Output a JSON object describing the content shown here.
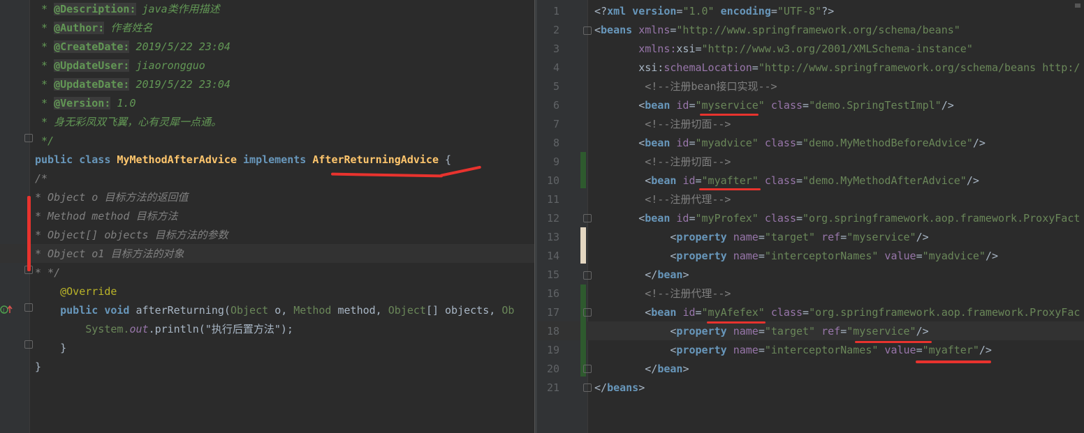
{
  "left_editor": {
    "lines": [
      {
        "parts": [
          [
            "jdoc",
            " * "
          ],
          [
            "jdtag",
            "@Description:"
          ],
          [
            "jdoc",
            " java类作用描述"
          ]
        ]
      },
      {
        "parts": [
          [
            "jdoc",
            " * "
          ],
          [
            "jdtag",
            "@Author:"
          ],
          [
            "jdoc",
            " 作者姓名"
          ]
        ]
      },
      {
        "parts": [
          [
            "jdoc",
            " * "
          ],
          [
            "jdtag",
            "@CreateDate:"
          ],
          [
            "jdoc",
            " 2019/5/22 23:04"
          ]
        ]
      },
      {
        "parts": [
          [
            "jdoc",
            " * "
          ],
          [
            "jdtag",
            "@UpdateUser:"
          ],
          [
            "jdoc",
            " jiaorongguo"
          ]
        ]
      },
      {
        "parts": [
          [
            "jdoc",
            " * "
          ],
          [
            "jdtag",
            "@UpdateDate:"
          ],
          [
            "jdoc",
            " 2019/5/22 23:04"
          ]
        ]
      },
      {
        "parts": [
          [
            "jdoc",
            " * "
          ],
          [
            "jdtag",
            "@Version:"
          ],
          [
            "jdoc",
            " 1.0"
          ]
        ]
      },
      {
        "parts": [
          [
            "jdoc",
            " * 身无彩凤双飞翼，心有灵犀一点通。"
          ]
        ]
      },
      {
        "parts": [
          [
            "jdoc",
            " */"
          ]
        ]
      },
      {
        "parts": [
          [
            "kwb",
            "public class "
          ],
          [
            "iface",
            "MyMethodAfterAdvice"
          ],
          [
            "kwb",
            " implements "
          ],
          [
            "iface",
            "AfterReturningAdvice"
          ],
          [
            "plain",
            " {"
          ]
        ]
      },
      {
        "parts": [
          [
            "comment-grey",
            "/*"
          ]
        ]
      },
      {
        "parts": [
          [
            "comment-grey",
            "* Object o 目标方法的返回值"
          ]
        ]
      },
      {
        "parts": [
          [
            "comment-grey",
            "* Method method 目标方法"
          ]
        ]
      },
      {
        "parts": [
          [
            "comment-grey",
            "* Object[] objects 目标方法的参数"
          ]
        ]
      },
      {
        "parts": [
          [
            "comment-grey",
            "* Object o1 目标方法的对象"
          ]
        ]
      },
      {
        "parts": [
          [
            "comment-grey",
            "* */"
          ]
        ]
      },
      {
        "parts": [
          [
            "ann",
            "    @Override"
          ]
        ]
      },
      {
        "parts": [
          [
            "kwb",
            "    public void "
          ],
          [
            "plain",
            "afterReturning("
          ],
          [
            "xmlval",
            "Object "
          ],
          [
            "plain",
            "o, "
          ],
          [
            "xmlval",
            "Method "
          ],
          [
            "plain",
            "method, "
          ],
          [
            "xmlval",
            "Object"
          ],
          [
            "plain",
            "[] objects, "
          ],
          [
            "xmlval",
            "Ob"
          ]
        ]
      },
      {
        "parts": [
          [
            "plain",
            "        "
          ],
          [
            "xmlval",
            "System."
          ],
          [
            "field",
            "out"
          ],
          [
            "plain",
            ".println("
          ],
          [
            "plain",
            "\"执行后置方法\""
          ],
          [
            "plain",
            ");"
          ]
        ]
      },
      {
        "parts": [
          [
            "plain",
            "    }"
          ]
        ]
      },
      {
        "parts": [
          [
            "plain",
            "}"
          ]
        ]
      }
    ]
  },
  "right_editor": {
    "lines": [
      {
        "n": "1",
        "parts": [
          [
            "plain",
            "<?"
          ],
          [
            "kwb",
            "xml version"
          ],
          [
            "plain",
            "="
          ],
          [
            "xmlval",
            "\"1.0\""
          ],
          [
            "kwb",
            " encoding"
          ],
          [
            "plain",
            "="
          ],
          [
            "xmlval",
            "\"UTF-8\""
          ],
          [
            "plain",
            "?>"
          ]
        ]
      },
      {
        "n": "2",
        "parts": [
          [
            "plain",
            "<"
          ],
          [
            "kwb",
            "beans "
          ],
          [
            "attr",
            "xmlns"
          ],
          [
            "plain",
            "="
          ],
          [
            "xmlval",
            "\"http://www.springframework.org/schema/beans\""
          ]
        ]
      },
      {
        "n": "3",
        "parts": [
          [
            "plain",
            "       "
          ],
          [
            "attr",
            "xmlns:"
          ],
          [
            "plain",
            "xsi="
          ],
          [
            "xmlval",
            "\"http://www.w3.org/2001/XMLSchema-instance\""
          ]
        ]
      },
      {
        "n": "4",
        "parts": [
          [
            "plain",
            "       xsi:"
          ],
          [
            "attr",
            "schemaLocation"
          ],
          [
            "plain",
            "="
          ],
          [
            "xmlval",
            "\"http://www.springframework.org/schema/beans http:/"
          ]
        ]
      },
      {
        "n": "5",
        "parts": [
          [
            "xmlcm",
            "        <!--注册bean接口实现-->"
          ]
        ]
      },
      {
        "n": "6",
        "parts": [
          [
            "plain",
            "       <"
          ],
          [
            "kwb",
            "bean "
          ],
          [
            "attr",
            "id"
          ],
          [
            "plain",
            "="
          ],
          [
            "xmlval",
            "\"myservice\""
          ],
          [
            "attr",
            " class"
          ],
          [
            "plain",
            "="
          ],
          [
            "xmlval",
            "\"demo.SpringTestImpl\""
          ],
          [
            "plain",
            "/>"
          ]
        ]
      },
      {
        "n": "7",
        "parts": [
          [
            "xmlcm",
            "        <!--注册切面-->"
          ]
        ]
      },
      {
        "n": "8",
        "parts": [
          [
            "plain",
            "       <"
          ],
          [
            "kwb",
            "bean "
          ],
          [
            "attr",
            "id"
          ],
          [
            "plain",
            "="
          ],
          [
            "xmlval",
            "\"myadvice\""
          ],
          [
            "attr",
            " class"
          ],
          [
            "plain",
            "="
          ],
          [
            "xmlval",
            "\"demo.MyMethodBeforeAdvice\""
          ],
          [
            "plain",
            "/>"
          ]
        ]
      },
      {
        "n": "9",
        "parts": [
          [
            "xmlcm",
            "        <!--注册切面-->"
          ]
        ]
      },
      {
        "n": "10",
        "parts": [
          [
            "plain",
            "        <"
          ],
          [
            "kwb",
            "bean "
          ],
          [
            "attr",
            "id"
          ],
          [
            "plain",
            "="
          ],
          [
            "xmlval",
            "\"myafter\""
          ],
          [
            "attr",
            " class"
          ],
          [
            "plain",
            "="
          ],
          [
            "xmlval",
            "\"demo.MyMethodAfterAdvice\""
          ],
          [
            "plain",
            "/>"
          ]
        ]
      },
      {
        "n": "11",
        "parts": [
          [
            "xmlcm",
            "        <!--注册代理-->"
          ]
        ]
      },
      {
        "n": "12",
        "parts": [
          [
            "plain",
            "       <"
          ],
          [
            "kwb",
            "bean "
          ],
          [
            "attr",
            "id"
          ],
          [
            "plain",
            "="
          ],
          [
            "xmlval",
            "\"myProfex\""
          ],
          [
            "attr",
            " class"
          ],
          [
            "plain",
            "="
          ],
          [
            "xmlval",
            "\"org.springframework.aop.framework.ProxyFact"
          ]
        ]
      },
      {
        "n": "13",
        "parts": [
          [
            "plain",
            "            <"
          ],
          [
            "kwb",
            "property "
          ],
          [
            "attr",
            "name"
          ],
          [
            "plain",
            "="
          ],
          [
            "xmlval",
            "\"target\""
          ],
          [
            "attr",
            " ref"
          ],
          [
            "plain",
            "="
          ],
          [
            "xmlval",
            "\"myservice\""
          ],
          [
            "plain",
            "/>"
          ]
        ]
      },
      {
        "n": "14",
        "parts": [
          [
            "plain",
            "            <"
          ],
          [
            "kwb",
            "property "
          ],
          [
            "attr",
            "name"
          ],
          [
            "plain",
            "="
          ],
          [
            "xmlval",
            "\"interceptorNames\""
          ],
          [
            "attr",
            " value"
          ],
          [
            "plain",
            "="
          ],
          [
            "xmlval",
            "\"myadvice\""
          ],
          [
            "plain",
            "/>"
          ]
        ]
      },
      {
        "n": "15",
        "parts": [
          [
            "plain",
            "        </"
          ],
          [
            "kwb",
            "bean"
          ],
          [
            "plain",
            ">"
          ]
        ]
      },
      {
        "n": "16",
        "parts": [
          [
            "xmlcm",
            "        <!--注册代理-->"
          ]
        ]
      },
      {
        "n": "17",
        "parts": [
          [
            "plain",
            "        <"
          ],
          [
            "kwb",
            "bean "
          ],
          [
            "attr",
            "id"
          ],
          [
            "plain",
            "="
          ],
          [
            "xmlval",
            "\"myAfefex\""
          ],
          [
            "attr",
            " class"
          ],
          [
            "plain",
            "="
          ],
          [
            "xmlval",
            "\"org.springframework.aop.framework.ProxyFac"
          ]
        ]
      },
      {
        "n": "18",
        "parts": [
          [
            "plain",
            "            <"
          ],
          [
            "kwb",
            "property "
          ],
          [
            "attr",
            "name"
          ],
          [
            "plain",
            "="
          ],
          [
            "xmlval",
            "\"target\""
          ],
          [
            "attr",
            " ref"
          ],
          [
            "plain",
            "="
          ],
          [
            "xmlval",
            "\"myservice\""
          ],
          [
            "plain",
            "/>"
          ]
        ]
      },
      {
        "n": "19",
        "parts": [
          [
            "plain",
            "            <"
          ],
          [
            "kwb",
            "property "
          ],
          [
            "attr",
            "name"
          ],
          [
            "plain",
            "="
          ],
          [
            "xmlval",
            "\"interceptorNames\""
          ],
          [
            "attr",
            " value"
          ],
          [
            "plain",
            "="
          ],
          [
            "xmlval",
            "\"myafter\""
          ],
          [
            "plain",
            "/>"
          ]
        ]
      },
      {
        "n": "20",
        "parts": [
          [
            "plain",
            "        </"
          ],
          [
            "kwb",
            "bean"
          ],
          [
            "plain",
            ">"
          ]
        ]
      },
      {
        "n": "21",
        "parts": [
          [
            "plain",
            "</"
          ],
          [
            "kwb",
            "beans"
          ],
          [
            "plain",
            ">"
          ]
        ]
      }
    ]
  },
  "colors": {
    "background": "#2b2b2b",
    "annotation_red": "#e8332e",
    "change_marker_green": "#2e5a2e"
  },
  "icons": [
    "fold-marker-icon",
    "override-marker-icon"
  ]
}
